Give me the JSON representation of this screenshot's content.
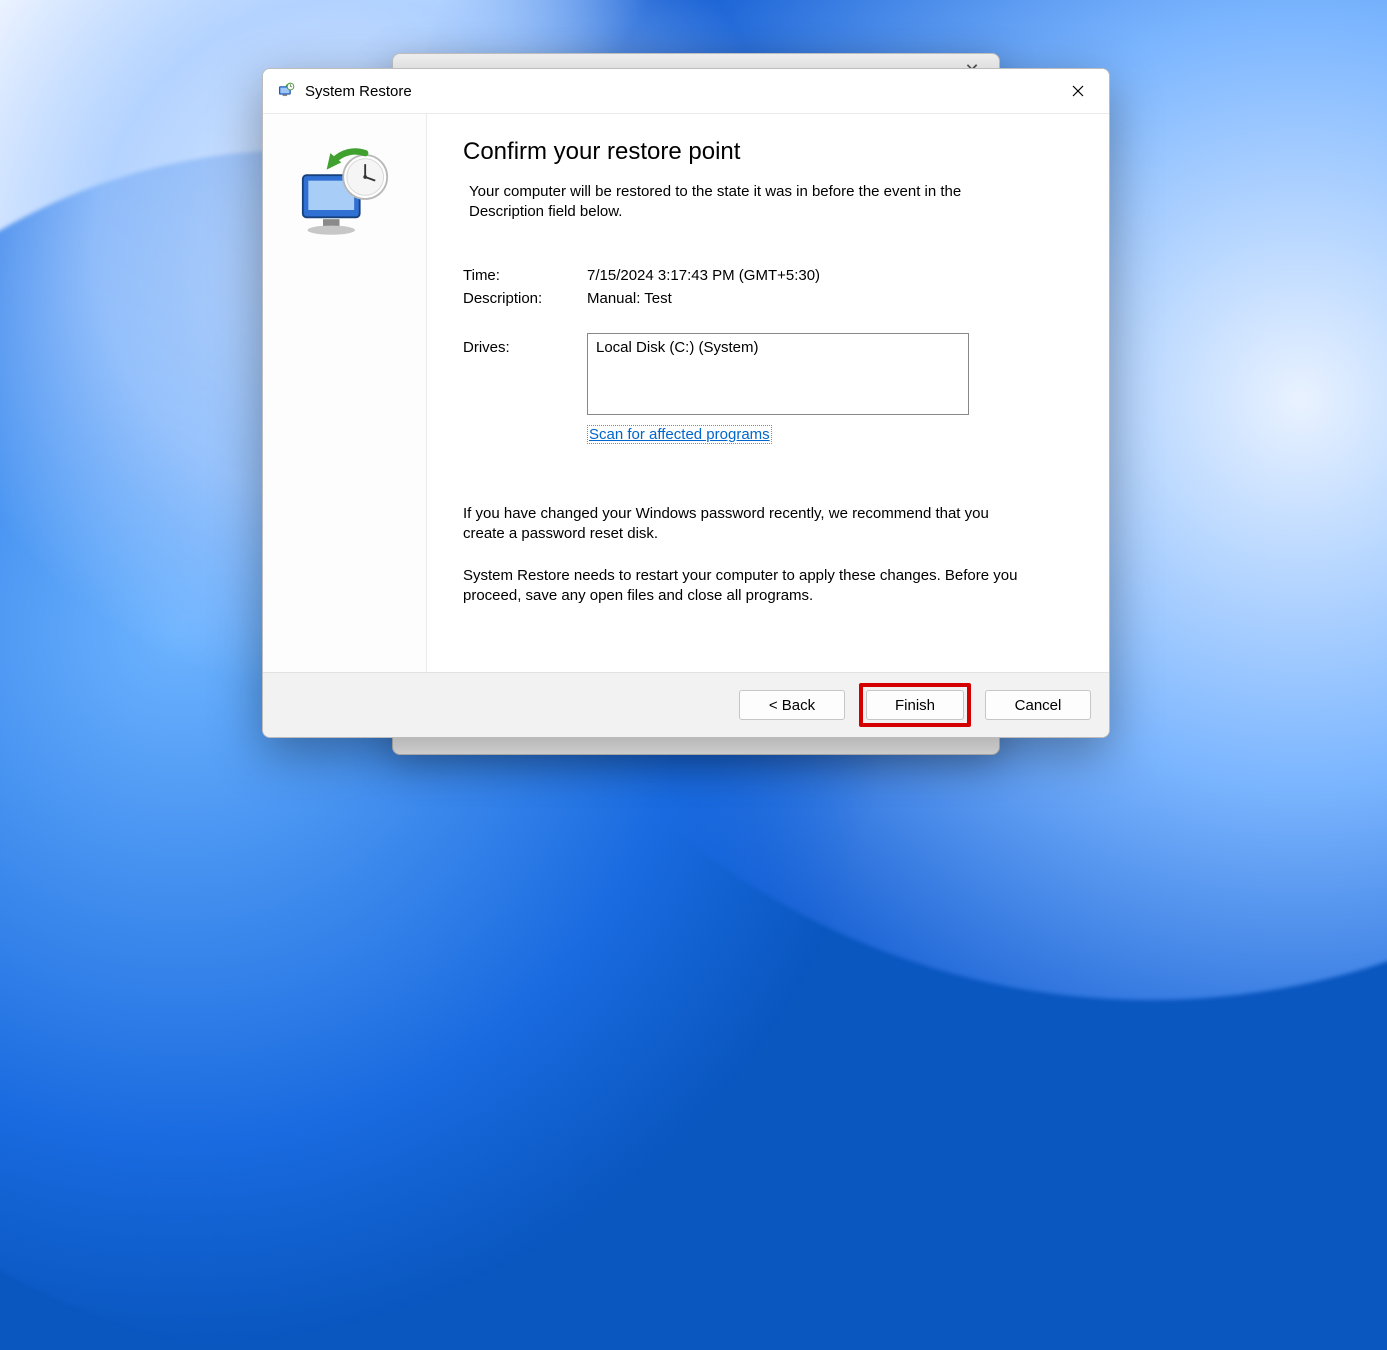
{
  "background_window": {
    "title_partial": "",
    "close_glyph": "✕"
  },
  "window": {
    "title": "System Restore"
  },
  "heading": "Confirm your restore point",
  "intro": "Your computer will be restored to the state it was in before the event in the Description field below.",
  "fields": {
    "time_label": "Time:",
    "time_value": "7/15/2024 3:17:43 PM (GMT+5:30)",
    "description_label": "Description:",
    "description_value": "Manual: Test",
    "drives_label": "Drives:",
    "drives_value": "Local Disk (C:) (System)"
  },
  "scan_link": "Scan for affected programs",
  "notes": {
    "password_note": "If you have changed your Windows password recently, we recommend that you create a password reset disk.",
    "restart_note": "System Restore needs to restart your computer to apply these changes. Before you proceed, save any open files and close all programs."
  },
  "buttons": {
    "back": "< Back",
    "finish": "Finish",
    "cancel": "Cancel"
  }
}
